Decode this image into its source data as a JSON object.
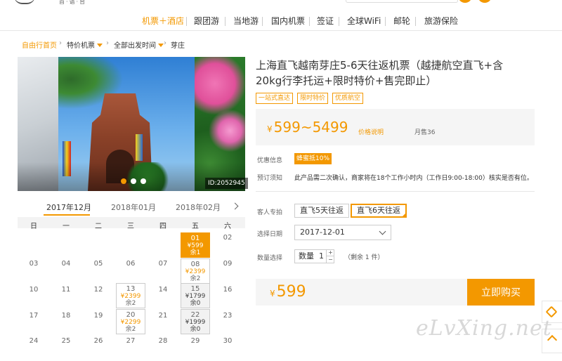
{
  "header": {
    "logo_sub": "首·语·台"
  },
  "nav": {
    "items": [
      {
        "label": "机票＋酒店",
        "active": true
      },
      {
        "label": "跟团游"
      },
      {
        "label": "当地游"
      },
      {
        "label": "国内机票"
      },
      {
        "label": "签证"
      },
      {
        "label": "全球WiFi"
      },
      {
        "label": "邮轮"
      },
      {
        "label": "旅游保险"
      }
    ]
  },
  "breadcrumb": {
    "home": "自由行首页",
    "cat": "特价机票",
    "origin": "全部出发时间",
    "current": "芽庄"
  },
  "gallery": {
    "id_label": "ID:2052945"
  },
  "product": {
    "title": "上海直飞越南芽庄5-6天往返机票（越捷航空直飞+含20kg行李托运+限时特价+售完即止）",
    "tags": [
      "一站式直达",
      "限时特价",
      "优质航空"
    ],
    "currency": "¥",
    "price_range": "599~5499",
    "price_note": "价格说明",
    "monthly_sales": "月售36"
  },
  "info": {
    "promo_label": "优惠信息",
    "promo_badge": "蜂蜜抵10%",
    "notice_label": "预订须知",
    "notice_text": "此产品需二次确认，商家将在18个工作小时内（工作日9:00-18:00）核实是否有位。"
  },
  "options": {
    "route_label": "客人专拍",
    "routes": [
      {
        "label": "直飞5天往返",
        "selected": false
      },
      {
        "label": "直飞6天往返",
        "selected": true
      }
    ],
    "date_label": "选择日期",
    "date_value": "2017-12-01",
    "qty_label": "数量选择",
    "qty_text": "数量",
    "qty_value": "1",
    "qty_plus": "+",
    "qty_minus": "−",
    "remain": "（剩余 1 件）"
  },
  "buy": {
    "currency": "¥",
    "price": "599",
    "button": "立即购买"
  },
  "calendar": {
    "tabs": [
      "2017年12月",
      "2018年01月",
      "2018年02月"
    ],
    "weekdays": [
      "日",
      "一",
      "二",
      "三",
      "四",
      "五",
      "六"
    ],
    "days": {
      "d1": {
        "n": "01",
        "p": "¥599",
        "r": "余1"
      },
      "d2": "02",
      "d3": "03",
      "d4": "04",
      "d5": "05",
      "d6": "06",
      "d7": "07",
      "d8": {
        "n": "08",
        "p": "¥2399",
        "r": "余2"
      },
      "d9": "09",
      "d10": "10",
      "d11": "11",
      "d12": "12",
      "d13": {
        "n": "13",
        "p": "¥2399",
        "r": "余2"
      },
      "d14": "14",
      "d15": {
        "n": "15",
        "p": "¥1799",
        "r": "余0"
      },
      "d16": "16",
      "d17": "17",
      "d18": "18",
      "d19": "19",
      "d20": {
        "n": "20",
        "p": "¥2299",
        "r": "余2"
      },
      "d21": "21",
      "d22": {
        "n": "22",
        "p": "¥1999",
        "r": "余0"
      },
      "d23": "23",
      "d24": "24",
      "d25": "25",
      "d26": "26",
      "d27": "27",
      "d28": "28",
      "d29": "29",
      "d30": "30"
    }
  },
  "watermark": "eLvXing.net",
  "colors": {
    "accent": "#f39800",
    "text": "#333333",
    "muted": "#999999"
  }
}
